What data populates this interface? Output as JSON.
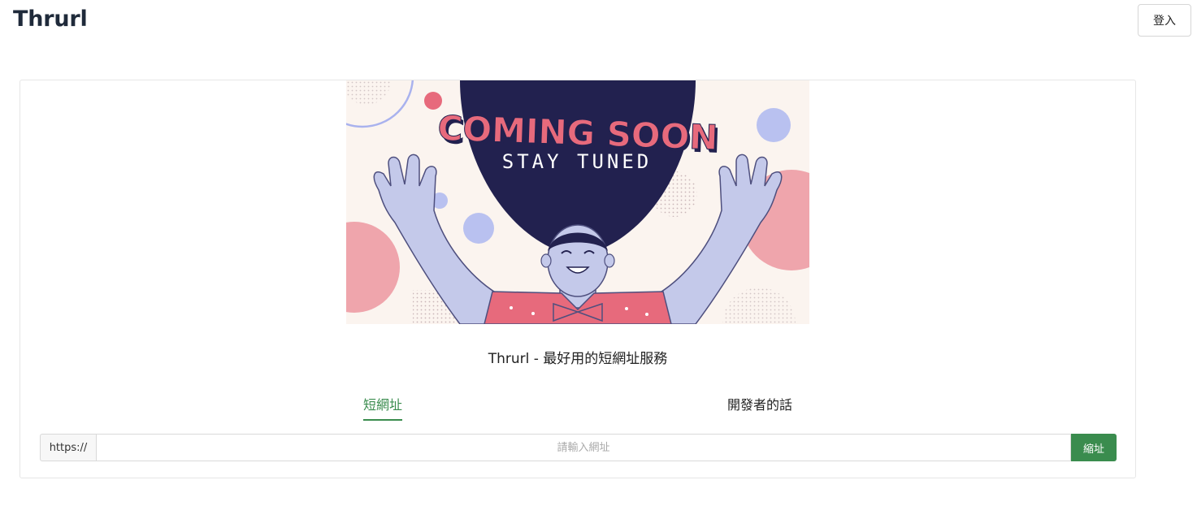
{
  "header": {
    "brand": "Thrurl",
    "login_label": "登入"
  },
  "hero": {
    "headline": "COMING SOON",
    "subline": "STAY TUNED",
    "background_color": "#fbf4ef",
    "hair_color": "#22214f",
    "skin_color": "#c4c9ea",
    "accent_color": "#e76a7c"
  },
  "main": {
    "tagline": "Thrurl - 最好用的短網址服務",
    "tabs": [
      {
        "label": "短網址",
        "active": true
      },
      {
        "label": "開發者的話",
        "active": false
      }
    ],
    "form": {
      "prefix": "https://",
      "placeholder": "請輸入網址",
      "value": "",
      "submit_label": "縮址"
    }
  },
  "colors": {
    "accent": "#3a8c4e",
    "brand_text": "#1f2a3a"
  }
}
